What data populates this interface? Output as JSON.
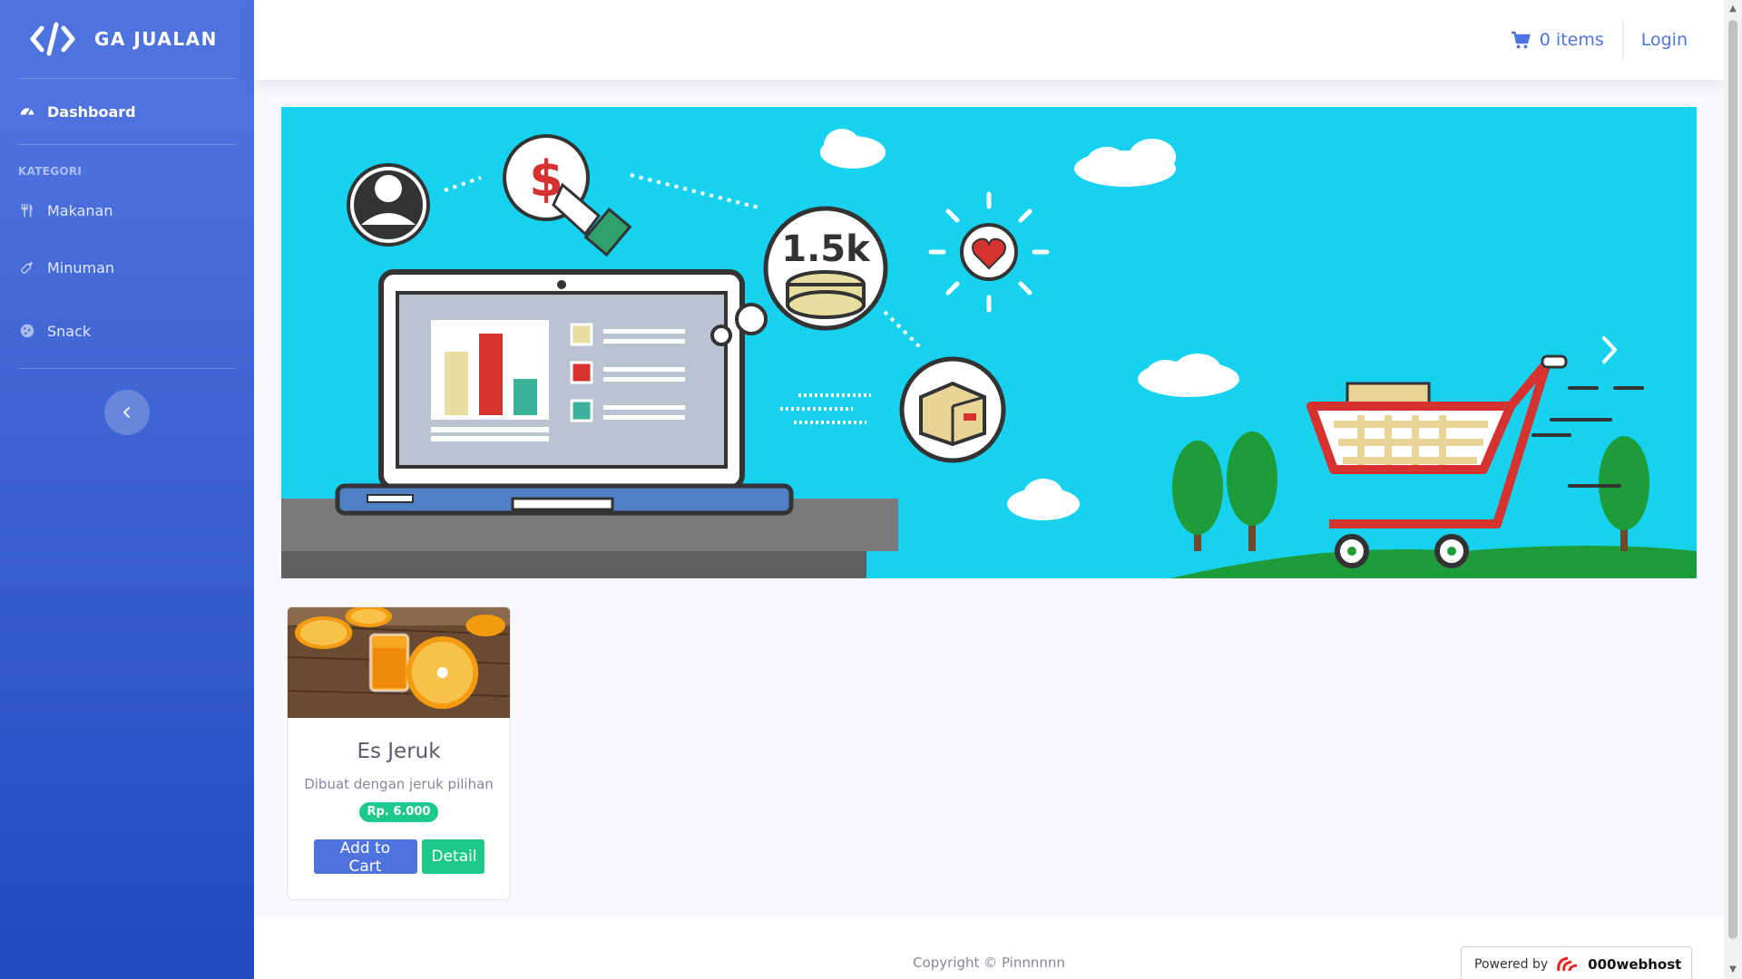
{
  "sidebar": {
    "brand": "GA JUALAN",
    "brand_icon": "code-icon",
    "dashboard_label": "Dashboard",
    "heading": "KATEGORI",
    "items": [
      {
        "label": "Makanan",
        "icon": "utensils-icon"
      },
      {
        "label": "Minuman",
        "icon": "bottle-icon"
      },
      {
        "label": "Snack",
        "icon": "cookie-icon"
      }
    ],
    "toggle_icon": "chevron-left-icon"
  },
  "topbar": {
    "cart_label": "0 items",
    "cart_icon": "cart-icon",
    "login_label": "Login"
  },
  "banner": {
    "coin_text": "1.5k",
    "dollar_text": "$"
  },
  "products": [
    {
      "name": "Es Jeruk",
      "description": "Dibuat dengan jeruk pilihan",
      "price": "Rp. 6.000",
      "add_label": "Add to Cart",
      "detail_label": "Detail"
    }
  ],
  "footer": {
    "copyright": "Copyright © Pinnnnnn",
    "powered_prefix": "Powered by",
    "powered_brand": "000webhost"
  },
  "colors": {
    "primary": "#4e73df",
    "success": "#1cc88a",
    "banner_bg": "#16d2ef"
  }
}
